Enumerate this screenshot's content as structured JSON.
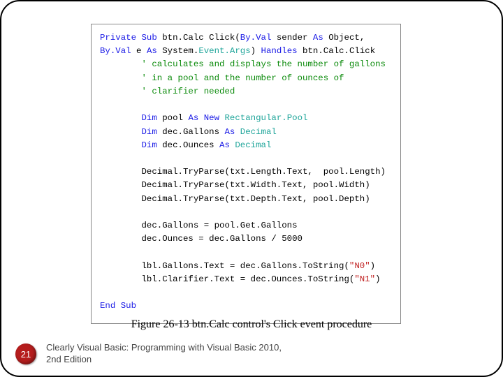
{
  "code": {
    "l01a": "Private Sub",
    "l01b": " btn.Calc Click(",
    "l01c": "By.Val",
    "l01d": " sender ",
    "l01e": "As",
    "l01f": " Object,",
    "l02a": "By.Val",
    "l02b": " e ",
    "l02c": "As",
    "l02d": " System.",
    "l02e": "Event.Args",
    "l02f": ") ",
    "l02g": "Handles",
    "l02h": " btn.Calc.Click",
    "c1": "        ' calculates and displays the number of gallons",
    "c2": "        ' in a pool and the number of ounces of",
    "c3": "        ' clarifier needed",
    "d1a": "        ",
    "dim": "Dim",
    "d1b": " pool ",
    "asnew": "As New",
    "d1c": " ",
    "rectpool": "Rectangular.Pool",
    "d2b": " dec.Gallons ",
    "as": "As",
    "d2c": " ",
    "decimal": "Decimal",
    "d3b": " dec.Ounces ",
    "p1": "        Decimal.TryParse(txt.Length.Text,  pool.Length)",
    "p2": "        Decimal.TryParse(txt.Width.Text, pool.Width)",
    "p3": "        Decimal.TryParse(txt.Depth.Text, pool.Depth)",
    "g1": "        dec.Gallons = pool.Get.Gallons",
    "g2": "        dec.Ounces = dec.Gallons / 5000",
    "o1a": "        lbl.Gallons.Text = dec.Gallons.ToString(",
    "o1b": "\"N0\"",
    "o1c": ")",
    "o2a": "        lbl.Clarifier.Text = dec.Ounces.ToString(",
    "o2b": "\"N1\"",
    "o2c": ")",
    "end": "End Sub"
  },
  "caption": "Figure 26-13 btn.Calc control's Click event procedure",
  "page_number": "21",
  "book_ref": "Clearly Visual Basic: Programming with Visual Basic 2010, 2nd Edition",
  "book_ref_sup": "nd"
}
